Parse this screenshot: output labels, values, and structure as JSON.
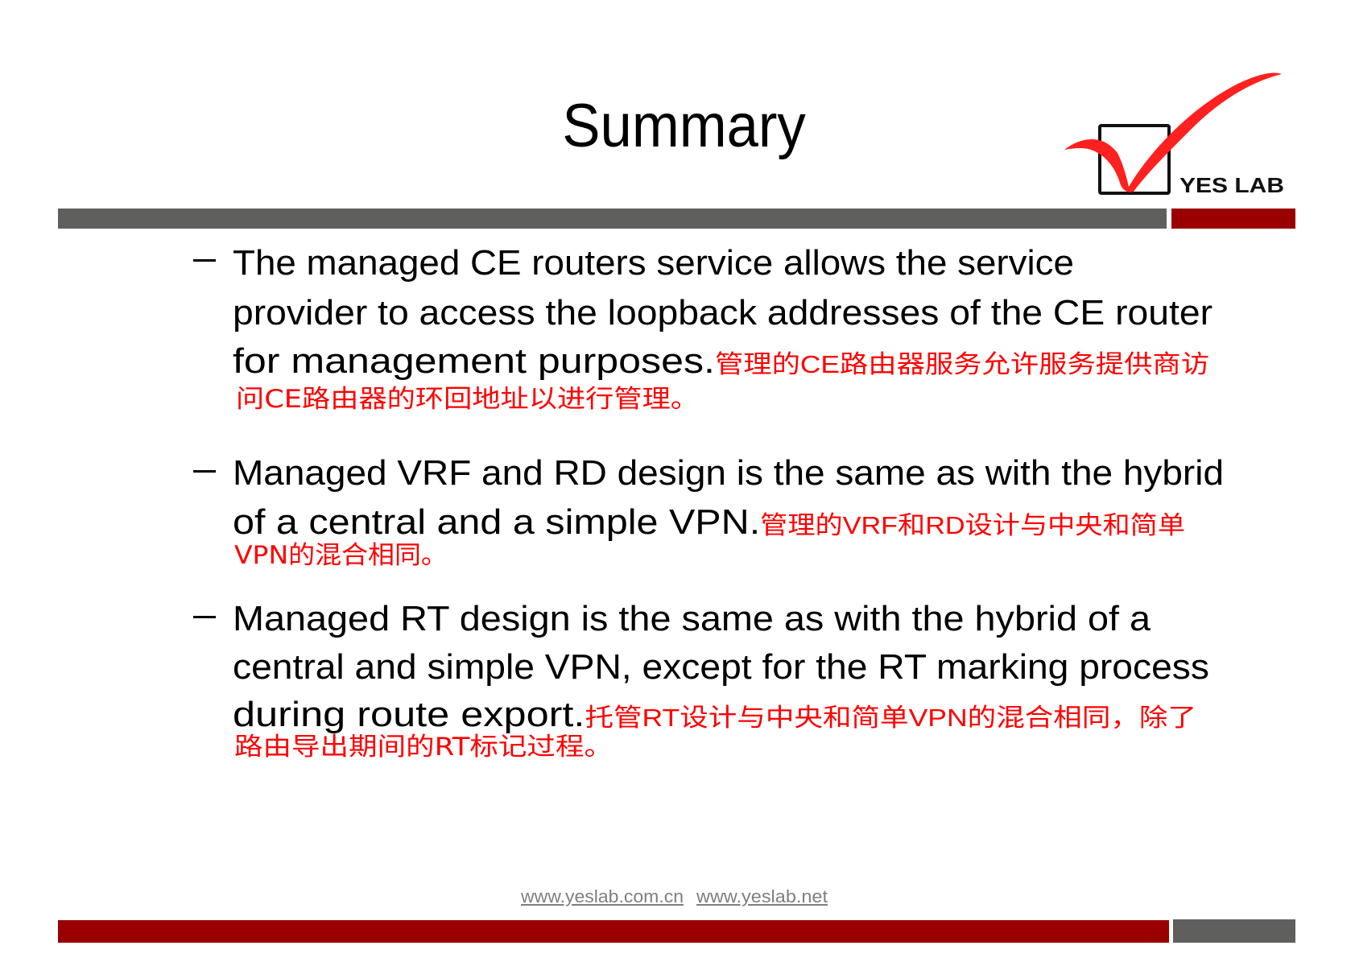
{
  "slide": {
    "title": "Summary",
    "logo": {
      "text": "YES LAB",
      "check_color": "#ff2020",
      "box_color": "#000000"
    },
    "colors": {
      "bar_gray": "#5f605e",
      "bar_red": "#9b0000",
      "body_text": "#000000",
      "translation_text": "#ff0000",
      "footer_link": "#7f7f7f"
    },
    "bullets": [
      {
        "marker": "–",
        "english_lines": [
          "The managed CE routers service allows the service",
          "provider to access the loopback addresses of the CE router",
          "for management purposes."
        ],
        "chinese_lines": [
          "管理的CE路由器服务允许服务提供商访",
          "问CE路由器的环回地址以进行管理。"
        ]
      },
      {
        "marker": "–",
        "english_lines": [
          "Managed VRF and RD design is the same as  with the hybrid",
          "of a central and a simple VPN."
        ],
        "chinese_lines": [
          "管理的VRF和RD设计与中央和简单",
          "VPN的混合相同。"
        ]
      },
      {
        "marker": "–",
        "english_lines": [
          "Managed RT design is the same as with the hybrid of a",
          "central and simple VPN, except for the RT marking process",
          "during route export."
        ],
        "chinese_lines": [
          "托管RT设计与中央和简单VPN的混合相同，除了",
          "路由导出期间的RT标记过程。"
        ]
      }
    ],
    "footer": {
      "links": [
        "www.yeslab.com.cn",
        "www.yeslab.net"
      ]
    }
  }
}
